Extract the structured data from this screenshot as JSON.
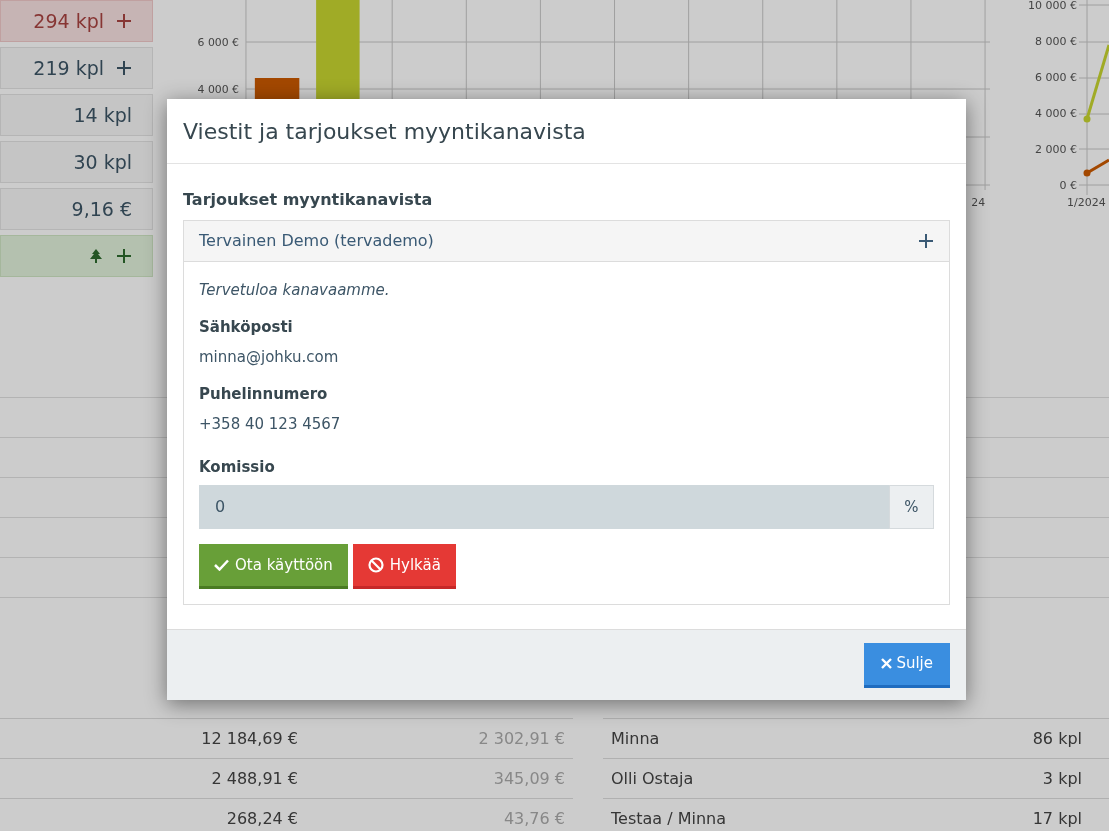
{
  "stat_boxes": [
    {
      "kind": "danger",
      "text": "294 kpl",
      "add": true
    },
    {
      "kind": "plain",
      "text": "219 kpl",
      "add": true
    },
    {
      "kind": "plain",
      "text": "14 kpl",
      "add": false
    },
    {
      "kind": "plain",
      "text": "30 kpl",
      "add": false
    },
    {
      "kind": "plain",
      "text": "9,16 €",
      "add": false
    },
    {
      "kind": "success",
      "add": true
    }
  ],
  "bar_chart": {
    "y_ticks": [
      "6 000 €",
      "4 000 €"
    ],
    "x_label": "24"
  },
  "line_chart": {
    "y_ticks": [
      "10 000 €",
      "8 000 €",
      "6 000 €",
      "4 000 €",
      "2 000 €",
      "0 €"
    ],
    "x_label": "1/2024"
  },
  "sales_table": {
    "rows": [
      {
        "total": "12 184,69 €",
        "tax": "2 302,91 €"
      },
      {
        "total": "2 488,91 €",
        "tax": "345,09 €"
      },
      {
        "total": "268,24 €",
        "tax": "43,76 €"
      }
    ]
  },
  "seller_table": {
    "rows": [
      {
        "name": "Minna",
        "count": "86 kpl"
      },
      {
        "name": "Olli Ostaja",
        "count": "3 kpl"
      },
      {
        "name": "Testaa / Minna",
        "count": "17 kpl"
      }
    ]
  },
  "dialog": {
    "title": "Viestit ja tarjoukset myyntikanavista",
    "section_title": "Tarjoukset myyntikanavista",
    "offer": {
      "name": "Tervainen Demo (tervademo)",
      "message": "Tervetuloa kanavaamme.",
      "fields": [
        {
          "label": "Sähköposti",
          "value": "minna@johku.com"
        },
        {
          "label": "Puhelinnumero",
          "value": "+358 40 123 4567"
        }
      ],
      "commission": {
        "label": "Komissio",
        "value": "0",
        "unit": "%"
      },
      "buttons": [
        {
          "kind": "accept",
          "label": "Ota käyttöön"
        },
        {
          "kind": "reject",
          "label": "Hylkää"
        }
      ]
    },
    "close_button": "Sulje"
  }
}
